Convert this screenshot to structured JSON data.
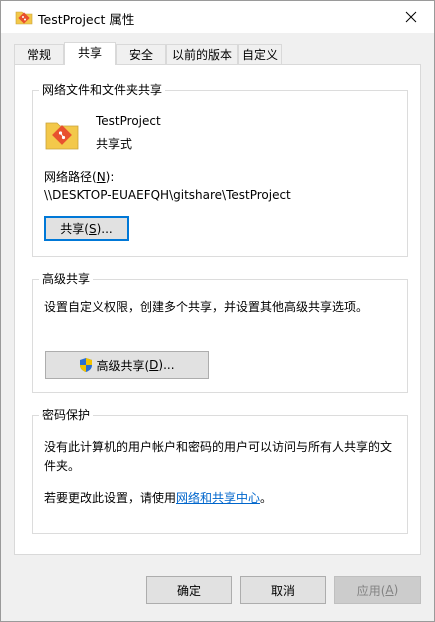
{
  "window": {
    "title": "TestProject 属性",
    "close_icon": "close-icon"
  },
  "tabs": [
    {
      "label": "常规",
      "active": false
    },
    {
      "label": "共享",
      "active": true
    },
    {
      "label": "安全",
      "active": false
    },
    {
      "label": "以前的版本",
      "active": false
    },
    {
      "label": "自定义",
      "active": false
    }
  ],
  "network_share": {
    "group_title": "网络文件和文件夹共享",
    "folder_name": "TestProject",
    "folder_status": "共享式",
    "path_label_prefix": "网络路径(",
    "path_label_key": "N",
    "path_label_suffix": "):",
    "path_value": "\\\\DESKTOP-EUAEFQH\\gitshare\\TestProject",
    "share_button_prefix": "共享(",
    "share_button_key": "S",
    "share_button_suffix": ")..."
  },
  "advanced_share": {
    "group_title": "高级共享",
    "description": "设置自定义权限，创建多个共享，并设置其他高级共享选项。",
    "button_prefix": "高级共享(",
    "button_key": "D",
    "button_suffix": ")..."
  },
  "password": {
    "group_title": "密码保护",
    "description_line1": "没有此计算机的用户帐户和密码的用户可以访问与所有人共享的文",
    "description_line2": "件夹。",
    "change_prefix": "若要更改此设置，请使用",
    "change_link": "网络和共享中心",
    "change_suffix": "。"
  },
  "footer": {
    "ok_label": "确定",
    "cancel_label": "取消",
    "apply_prefix": "应用(",
    "apply_key": "A",
    "apply_suffix": ")"
  },
  "colors": {
    "folder": "#f3c84a",
    "git_badge": "#e8512e",
    "shield_blue": "#2a6fd1",
    "shield_yellow": "#f2c200",
    "link": "#0066cc",
    "focus": "#0078d7"
  }
}
